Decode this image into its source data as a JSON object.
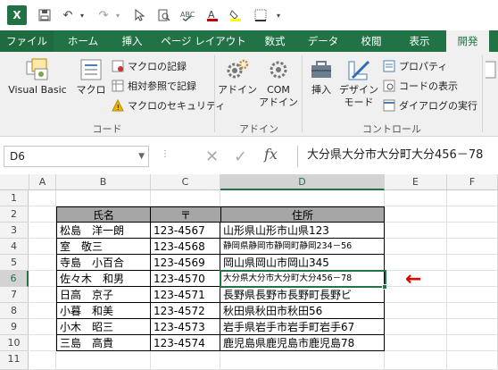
{
  "qat": {
    "app_logo": "X",
    "save_icon": "save-icon",
    "undo_icon": "undo-icon",
    "redo_icon": "redo-icon"
  },
  "tabs": [
    "ファイル",
    "ホーム",
    "挿入",
    "ページ レイアウト",
    "数式",
    "データ",
    "校閲",
    "表示",
    "開発"
  ],
  "ribbon": {
    "code_group": {
      "label": "コード",
      "visual_basic": "Visual Basic",
      "macro": "マクロ",
      "record_macro": "マクロの記録",
      "relative_ref": "相対参照で記録",
      "macro_security": "マクロのセキュリティ"
    },
    "addin_group": {
      "label": "アドイン",
      "addin": "アドイン",
      "com_addin_line1": "COM",
      "com_addin_line2": "アドイン"
    },
    "control_group": {
      "label": "コントロール",
      "insert": "挿入",
      "design_mode_line1": "デザイン",
      "design_mode_line2": "モード",
      "properties": "プロパティ",
      "view_code": "コードの表示",
      "run_dialog": "ダイアログの実行"
    }
  },
  "formula_bar": {
    "name_box": "D6",
    "fx": "fx",
    "formula": "大分県大分市大分町大分456－78"
  },
  "columns": [
    "A",
    "B",
    "C",
    "D",
    "E",
    "F"
  ],
  "rows": [
    "1",
    "2",
    "3",
    "4",
    "5",
    "6",
    "7",
    "8",
    "9",
    "10",
    "11"
  ],
  "table": {
    "headers": [
      "氏名",
      "〒",
      "住所"
    ],
    "rows": [
      {
        "name": "松島　洋一朗",
        "zip": "123-4567",
        "addr": "山形県山形市山県123"
      },
      {
        "name": "室　敬三",
        "zip": "123-4568",
        "addr": "静岡県静岡市静岡町静岡234－56"
      },
      {
        "name": "寺島　小百合",
        "zip": "123-4569",
        "addr": "岡山県岡山市岡山345"
      },
      {
        "name": "佐々木　和男",
        "zip": "123-4570",
        "addr": "大分県大分市大分町大分456－78"
      },
      {
        "name": "日高　京子",
        "zip": "123-4571",
        "addr": "長野県長野市長野町長野ビ"
      },
      {
        "name": "小暮　和美",
        "zip": "123-4572",
        "addr": "秋田県秋田市秋田56"
      },
      {
        "name": "小木　昭三",
        "zip": "123-4573",
        "addr": "岩手県岩手市岩手町岩手67"
      },
      {
        "name": "三島　高貴",
        "zip": "123-4574",
        "addr": "鹿児島県鹿児島市鹿児島78"
      }
    ]
  },
  "annotation_arrow": "←",
  "colors": {
    "accent": "#217346",
    "arrow": "#e00000",
    "header_fill": "#a6a6a6"
  }
}
